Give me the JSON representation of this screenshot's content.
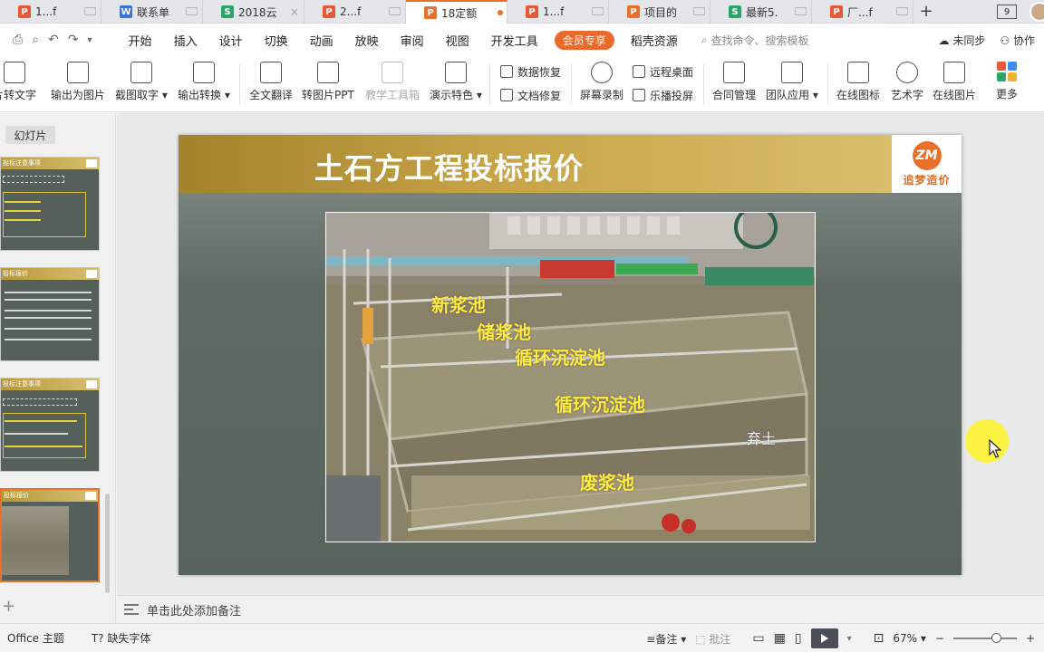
{
  "tabs": [
    {
      "label": "1...f",
      "icon": "P",
      "color": "#e8593a"
    },
    {
      "label": "联系单",
      "icon": "W",
      "color": "#3b74d8"
    },
    {
      "label": "2018云",
      "icon": "S",
      "color": "#2aa56a"
    },
    {
      "label": "2...f",
      "icon": "P",
      "color": "#e8593a"
    },
    {
      "label": "18定额",
      "icon": "P",
      "color": "#e8702a",
      "active": true
    },
    {
      "label": "1...f",
      "icon": "P",
      "color": "#e8593a"
    },
    {
      "label": "项目的",
      "icon": "P",
      "color": "#e8702a"
    },
    {
      "label": "最新5.",
      "icon": "S",
      "color": "#2aa56a"
    },
    {
      "label": "厂...f",
      "icon": "P",
      "color": "#e8593a"
    }
  ],
  "tab_new": "+",
  "window_count": "9",
  "menu": {
    "items": [
      "开始",
      "插入",
      "设计",
      "切换",
      "动画",
      "放映",
      "审阅",
      "视图",
      "开发工具"
    ],
    "vip": "会员专享",
    "extra": "稻壳资源",
    "search_placeholder": "查找命令、搜索模板",
    "sync": "未同步",
    "collab": "协作"
  },
  "ribbon": {
    "img_to_text": "片转文字",
    "export_image": "输出为图片",
    "screenshot_text": "截图取字",
    "export_convert": "输出转换",
    "translate": "全文翻译",
    "img_to_ppt": "转图片PPT",
    "teaching_tools": "教学工具箱",
    "demo_features": "演示特色",
    "data_recovery": "数据恢复",
    "doc_repair": "文档修复",
    "screen_record": "屏幕录制",
    "remote_desktop": "远程桌面",
    "cast_screen": "乐播投屏",
    "contract_mgmt": "合同管理",
    "team_apps": "团队应用",
    "online_icons": "在线图标",
    "art_text": "艺术字",
    "online_images": "在线图片",
    "more": "更多"
  },
  "panel": {
    "tab_label": "幻灯片",
    "thumbs": [
      {
        "title": "投标注意事项"
      },
      {
        "title": "投标报价"
      },
      {
        "title": "投标注意事项"
      },
      {
        "title": "投标报价"
      }
    ]
  },
  "slide": {
    "title": "土石方工程投标报价",
    "logo_text": "追梦造价",
    "logo_mark": "ZM",
    "labels": [
      "新浆池",
      "储浆池",
      "循环沉淀池",
      "循环沉淀池",
      "弃土",
      "废浆池"
    ]
  },
  "notes_placeholder": "单击此处添加备注",
  "status": {
    "theme": "Office 主题",
    "missing_font": "缺失字体",
    "notes": "备注",
    "comments": "批注",
    "zoom": "67%",
    "zoom_fraction": 0.67
  },
  "colors": {
    "accent": "#e8702a",
    "banner_gold": "#c7a447",
    "slide_bg": "#57635c",
    "label_yellow": "#ffeb3b"
  }
}
